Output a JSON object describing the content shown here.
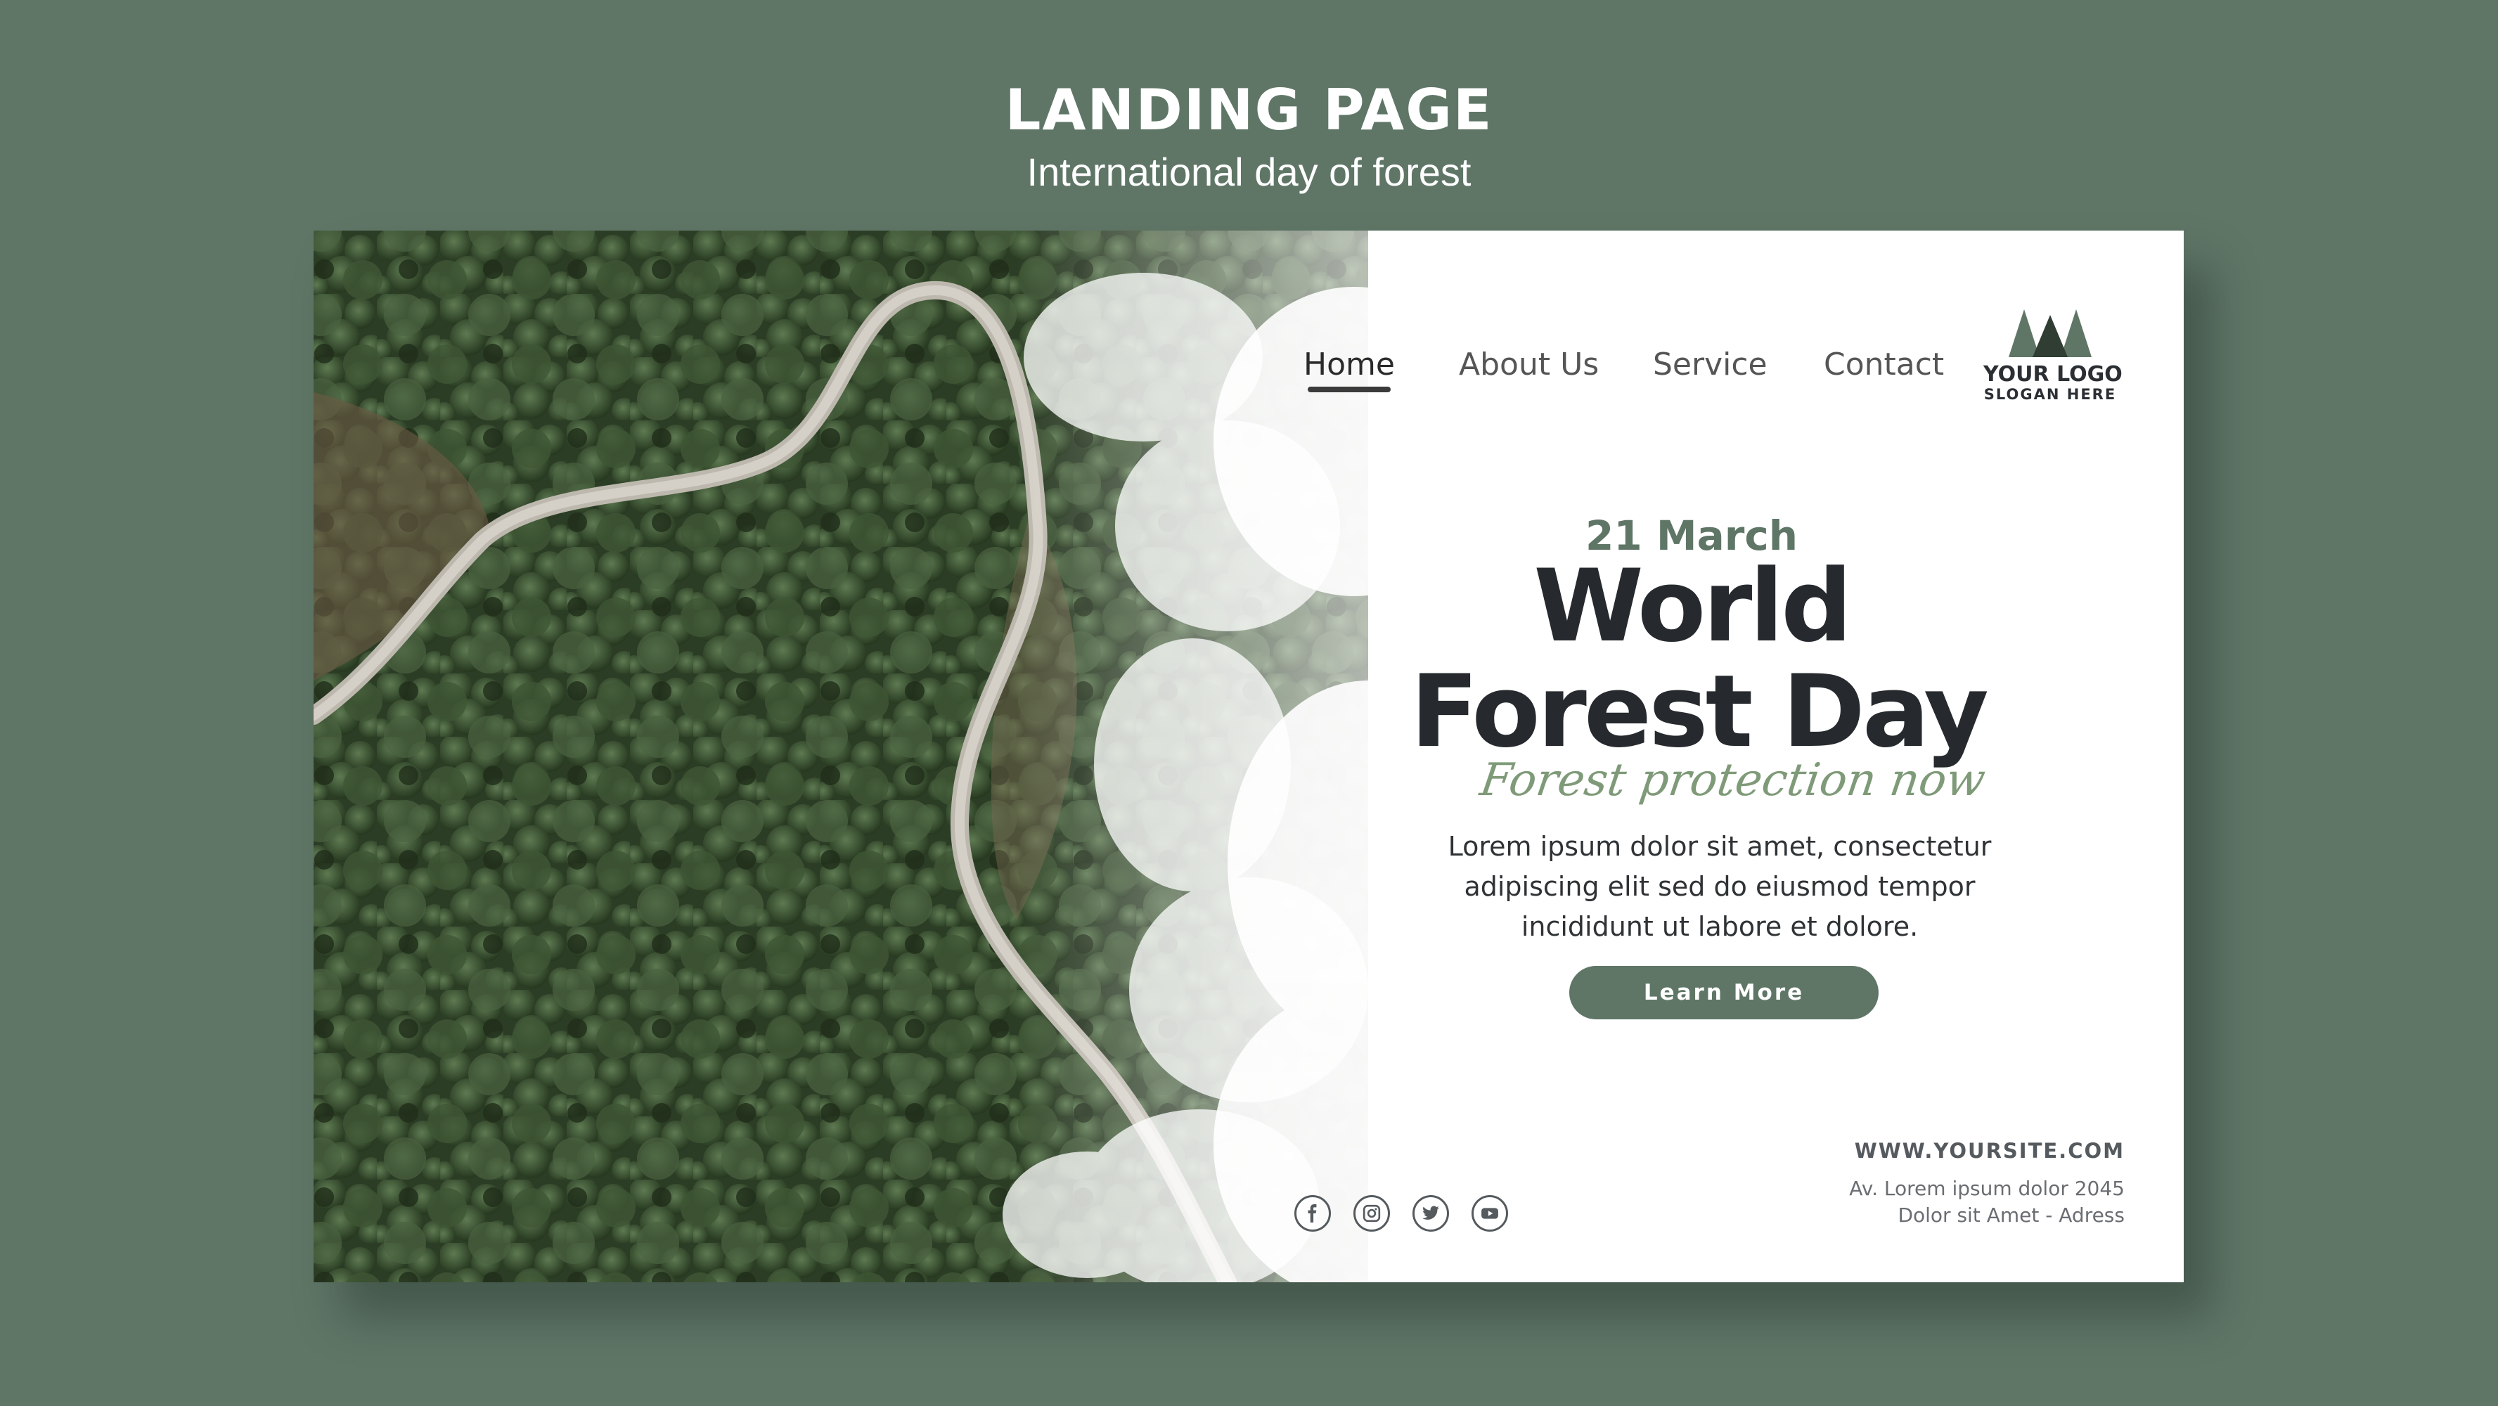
{
  "presentation": {
    "title": "LANDING PAGE",
    "subtitle": "International day of forest"
  },
  "nav": {
    "items": [
      {
        "label": "Home",
        "active": true
      },
      {
        "label": "About Us",
        "active": false
      },
      {
        "label": "Service",
        "active": false
      },
      {
        "label": "Contact",
        "active": false
      }
    ]
  },
  "logo": {
    "icon": "pine-trees-icon",
    "text": "YOUR LOGO",
    "slogan": "SLOGAN HERE"
  },
  "hero": {
    "date": "21 March",
    "headline_line1": "World",
    "headline_line2": "Forest Day",
    "script": "Forest protection now",
    "body_line1": "Lorem ipsum dolor sit amet, consectetur",
    "body_line2": "adipiscing elit sed do eiusmod tempor",
    "body_line3": "incididunt ut labore et dolore.",
    "cta_label": "Learn More"
  },
  "socials": [
    {
      "icon": "facebook-icon"
    },
    {
      "icon": "instagram-icon"
    },
    {
      "icon": "twitter-icon"
    },
    {
      "icon": "youtube-icon"
    }
  ],
  "footer": {
    "website": "WWW.YOURSITE.COM",
    "address_line1": "Av. Lorem ipsum dolor 2045",
    "address_line2": "Dolor sit Amet - Adress"
  },
  "colors": {
    "background": "#5f7667",
    "accent": "#5f7667",
    "script": "#7f9a78",
    "headline": "#262a2e"
  }
}
